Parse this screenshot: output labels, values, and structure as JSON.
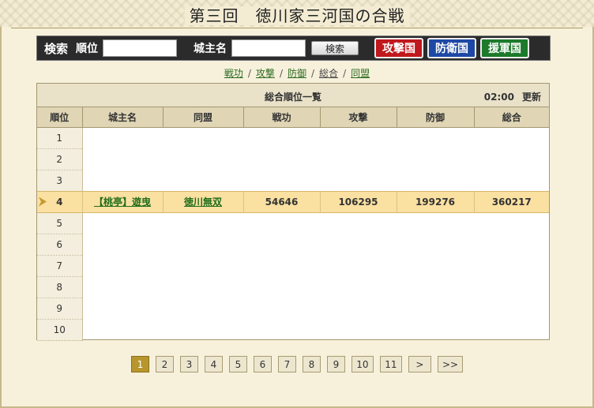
{
  "title": "第三回　徳川家三河国の合戦",
  "search": {
    "label": "検索",
    "rank_label": "順位",
    "rank_value": "",
    "name_label": "城主名",
    "name_value": "",
    "button": "検索"
  },
  "nation_buttons": {
    "attack": "攻撃国",
    "defense": "防衛国",
    "reinforce": "援軍国"
  },
  "sublinks": [
    {
      "label": "戦功",
      "current": false
    },
    {
      "label": "攻撃",
      "current": false
    },
    {
      "label": "防御",
      "current": false
    },
    {
      "label": "総合",
      "current": true
    },
    {
      "label": "同盟",
      "current": false
    }
  ],
  "sublink_sep": "/",
  "table": {
    "caption": "総合順位一覧",
    "time": "02:00",
    "refresh": "更新",
    "columns": [
      "順位",
      "城主名",
      "同盟",
      "戦功",
      "攻撃",
      "防御",
      "総合"
    ],
    "rows": [
      {
        "rank": "1",
        "name": "",
        "alliance": "",
        "merit": "",
        "attack": "",
        "defense": "",
        "total": ""
      },
      {
        "rank": "2",
        "name": "",
        "alliance": "",
        "merit": "",
        "attack": "",
        "defense": "",
        "total": ""
      },
      {
        "rank": "3",
        "name": "",
        "alliance": "",
        "merit": "",
        "attack": "",
        "defense": "",
        "total": ""
      },
      {
        "rank": "4",
        "name": "【桃亭】遊曳",
        "alliance": "徳川無双",
        "merit": "54646",
        "attack": "106295",
        "defense": "199276",
        "total": "360217"
      },
      {
        "rank": "5",
        "name": "",
        "alliance": "",
        "merit": "",
        "attack": "",
        "defense": "",
        "total": ""
      },
      {
        "rank": "6",
        "name": "",
        "alliance": "",
        "merit": "",
        "attack": "",
        "defense": "",
        "total": ""
      },
      {
        "rank": "7",
        "name": "",
        "alliance": "",
        "merit": "",
        "attack": "",
        "defense": "",
        "total": ""
      },
      {
        "rank": "8",
        "name": "",
        "alliance": "",
        "merit": "",
        "attack": "",
        "defense": "",
        "total": ""
      },
      {
        "rank": "9",
        "name": "",
        "alliance": "",
        "merit": "",
        "attack": "",
        "defense": "",
        "total": ""
      },
      {
        "rank": "10",
        "name": "",
        "alliance": "",
        "merit": "",
        "attack": "",
        "defense": "",
        "total": ""
      }
    ],
    "highlight_rank": "4"
  },
  "pager": {
    "pages": [
      "1",
      "2",
      "3",
      "4",
      "5",
      "6",
      "7",
      "8",
      "9",
      "10",
      "11"
    ],
    "current": "1",
    "next": ">",
    "last": ">>"
  },
  "colors": {
    "attack": "#c0181c",
    "defense": "#1e48a5",
    "reinforce": "#1c7a2b",
    "highlight_row": "#fae0a1",
    "active_page": "#b8962e"
  },
  "icons": {
    "row_marker": "current-row-arrow-icon"
  }
}
